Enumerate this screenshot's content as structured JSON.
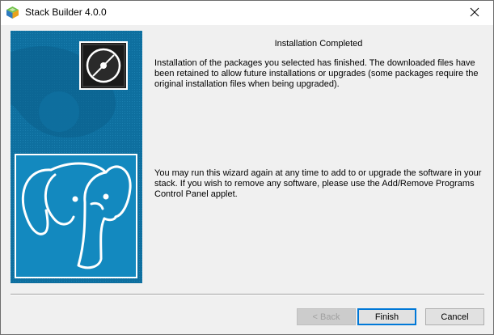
{
  "window": {
    "title": "Stack Builder 4.0.0"
  },
  "content": {
    "heading": "Installation Completed",
    "paragraph1": "Installation of the packages you selected has finished. The downloaded files have been retained to allow future installations or upgrades (some packages require the original installation files when being upgraded).",
    "paragraph2": "You may run this wizard again at any time to add to or upgrade the software in your stack. If you wish to remove any software, please use the Add/Remove Programs Control Panel applet."
  },
  "buttons": {
    "back": "< Back",
    "finish": "Finish",
    "cancel": "Cancel"
  },
  "colors": {
    "panel_blue": "#0e6f9f",
    "default_button_border": "#0078d7"
  }
}
